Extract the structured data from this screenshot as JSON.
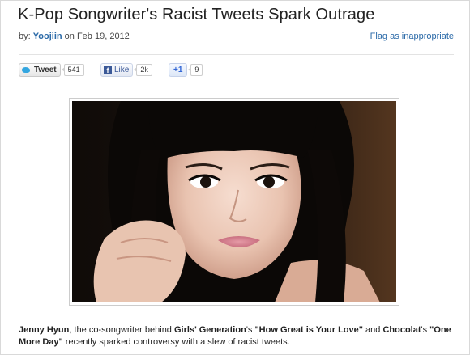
{
  "article": {
    "title": "K-Pop Songwriter's Racist Tweets Spark Outrage",
    "byline_prefix": "by:",
    "author": "Yoojiin",
    "date_text": "on Feb 19, 2012",
    "flag_link": "Flag as inappropriate"
  },
  "share": {
    "tweet_label": "Tweet",
    "tweet_count": "541",
    "like_label": "Like",
    "like_count": "2k",
    "plusone_label": "+1",
    "plusone_count": "9"
  },
  "photo": {
    "icon": "portrait-photo-icon"
  },
  "caption": {
    "name": "Jenny Hyun",
    "t1": ", the co-songwriter behind ",
    "group1": "Girls' Generation",
    "t2": "'s ",
    "song1": "\"How Great is Your Love\"",
    "t3": " and ",
    "group2": "Chocolat",
    "t4": "'s ",
    "song2": "\"One More Day\"",
    "t5": " recently sparked controversy with a slew of racist tweets."
  },
  "colors": {
    "link": "#2b6aa8",
    "facebook": "#3b5998",
    "twitter": "#33a6e0",
    "google": "#3367d6"
  }
}
